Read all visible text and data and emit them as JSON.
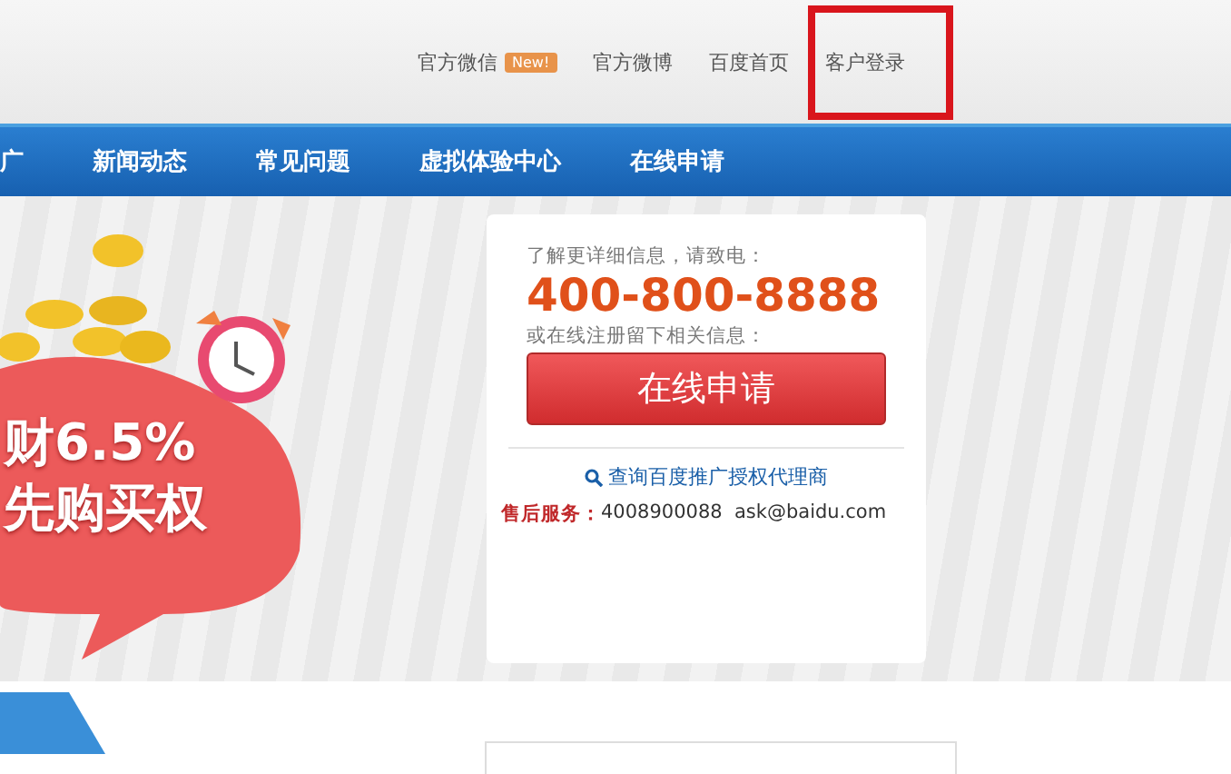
{
  "top_links": [
    {
      "label": "官方微信",
      "badge": "New!",
      "highlighted": false
    },
    {
      "label": "官方微博",
      "highlighted": false
    },
    {
      "label": "百度首页",
      "highlighted": false
    },
    {
      "label": "客户登录",
      "highlighted": true
    }
  ],
  "nav": [
    "广",
    "新闻动态",
    "常见问题",
    "虚拟体验中心",
    "在线申请"
  ],
  "banner": {
    "lines": [
      "财6.5%",
      "先购买权"
    ]
  },
  "contact_card": {
    "intro": "了解更详细信息，请致电：",
    "phone": "400-800-8888",
    "register_hint": "或在线注册留下相关信息：",
    "apply_button": "在线申请",
    "agent_link": "查询百度推广授权代理商",
    "service_label": "售后服务：",
    "service_value": "4008900088  ask@baidu.com"
  }
}
